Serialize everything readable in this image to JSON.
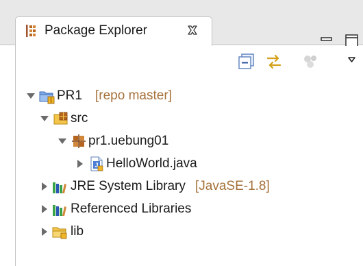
{
  "view": {
    "tab_title": "Package Explorer",
    "tab_icon": "package-explorer-icon",
    "close_icon": "close-x-icon"
  },
  "window_controls": [
    "minimize-icon",
    "maximize-icon"
  ],
  "toolbar": [
    "collapse-all-icon",
    "link-with-editor-icon",
    "focus-on-active-task-icon",
    "view-menu-chevron-icon"
  ],
  "tree": {
    "project": {
      "name": "PR1",
      "decoration": "[repo master]",
      "expanded": true,
      "icon": "git-project-icon"
    },
    "src": {
      "name": "src",
      "expanded": true,
      "icon": "source-folder-icon"
    },
    "package": {
      "name": "pr1.uebung01",
      "expanded": true,
      "icon": "package-icon"
    },
    "file": {
      "name": "HelloWorld.java",
      "expanded": false,
      "icon": "java-file-icon"
    },
    "jre": {
      "name": "JRE System Library",
      "decoration": "[JavaSE-1.8]",
      "expanded": false,
      "icon": "library-icon"
    },
    "reflibs": {
      "name": "Referenced Libraries",
      "expanded": false,
      "icon": "library-icon"
    },
    "lib": {
      "name": "lib",
      "expanded": false,
      "icon": "folder-icon"
    }
  },
  "colors": {
    "decoration": "#a5713a",
    "tab_bg": "#ffffff",
    "bar_bg": "#e8e8e8",
    "border": "#c4c4c4",
    "library_green": "#3aa34a",
    "library_blue": "#2b56b3",
    "folder_yellow": "#f3c54b",
    "package_brown": "#b5651d"
  }
}
